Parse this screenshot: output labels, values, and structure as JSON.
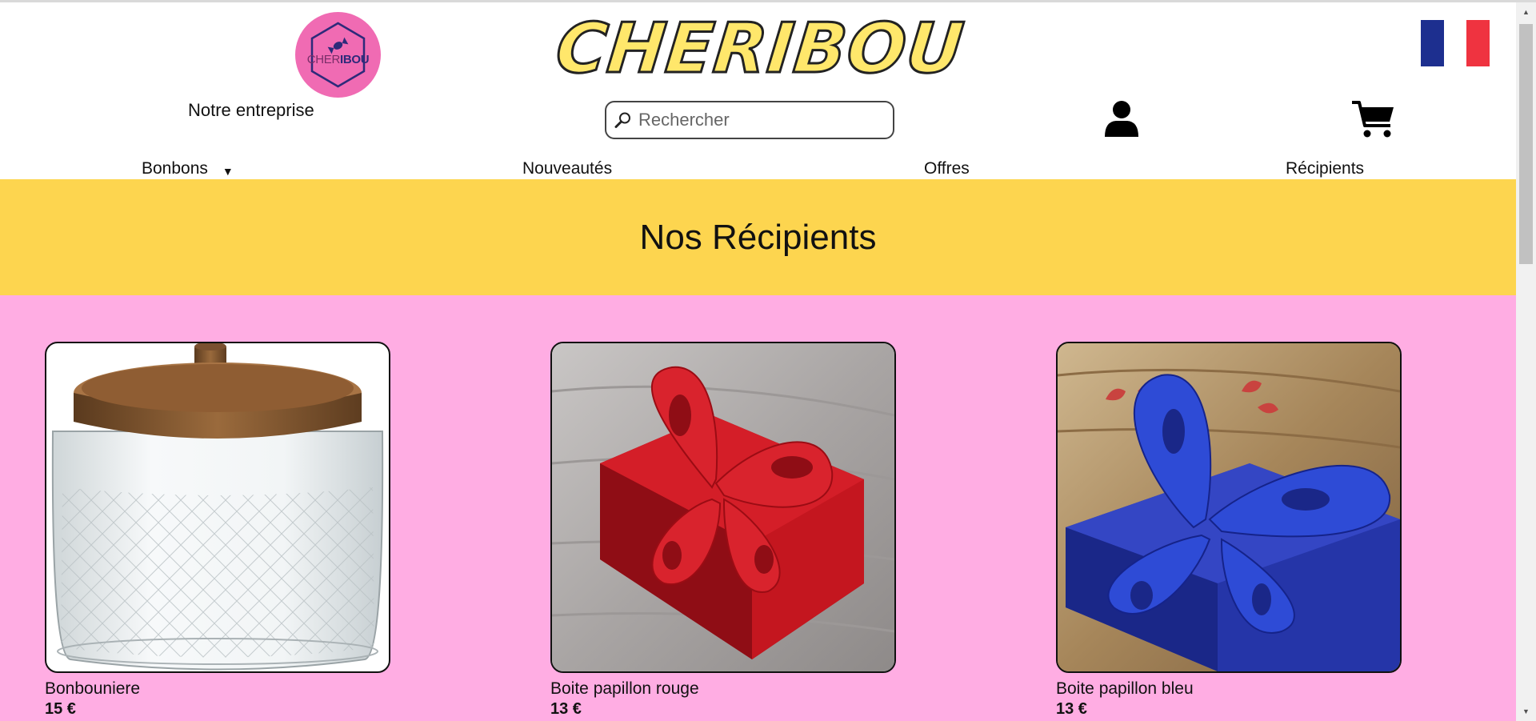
{
  "header": {
    "logo": {
      "text_a": "CHER",
      "text_b": "IBOU"
    },
    "company_link": "Notre entreprise",
    "brand": "CHERIBOU",
    "search": {
      "placeholder": "Rechercher"
    },
    "language": "fr-flag-icon"
  },
  "nav": {
    "items": [
      {
        "label": "Bonbons",
        "has_dropdown": true
      },
      {
        "label": "Nouveautés"
      },
      {
        "label": "Offres"
      },
      {
        "label": "Récipients"
      }
    ],
    "caret": "▼"
  },
  "banner": {
    "title": "Nos Récipients"
  },
  "products": [
    {
      "name": "Bonbouniere",
      "price": "15 €"
    },
    {
      "name": "Boite papillon rouge",
      "price": "13 €"
    },
    {
      "name": "Boite papillon bleu",
      "price": "13 €"
    }
  ],
  "colors": {
    "banner": "#fdd54f",
    "content_bg": "#ffade3",
    "logo_pink": "#f06bb3",
    "brand_yellow": "#ffe76b"
  },
  "scrollbar": {
    "up": "▲",
    "down": "▼"
  }
}
